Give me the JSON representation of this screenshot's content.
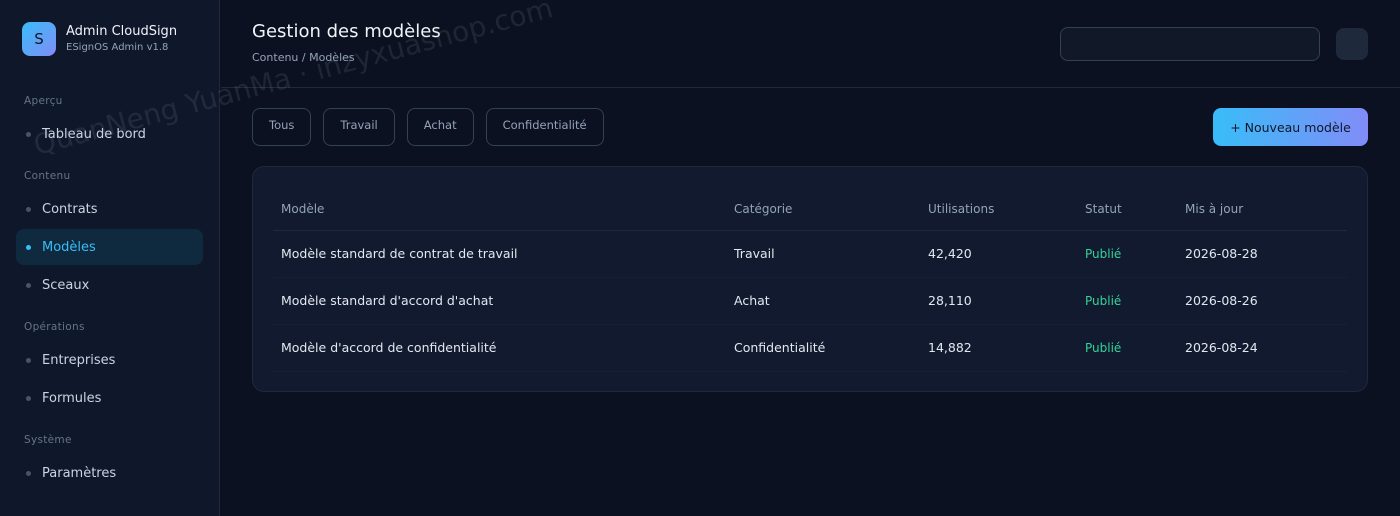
{
  "brand": {
    "logo_letter": "S",
    "title": "Admin CloudSign",
    "subtitle": "ESignOS Admin v1.8"
  },
  "sidebar": {
    "sections": [
      {
        "label": "Aperçu"
      },
      {
        "label": "Contenu"
      },
      {
        "label": "Opérations"
      },
      {
        "label": "Système"
      }
    ],
    "items": [
      {
        "label": "Tableau de bord",
        "active": false
      },
      {
        "label": "Contrats",
        "active": false
      },
      {
        "label": "Modèles",
        "active": true
      },
      {
        "label": "Sceaux",
        "active": false
      },
      {
        "label": "Entreprises",
        "active": false
      },
      {
        "label": "Formules",
        "active": false
      },
      {
        "label": "Paramètres",
        "active": false
      }
    ]
  },
  "header": {
    "title": "Gestion des modèles",
    "breadcrumb": "Contenu / Modèles",
    "search_value": ""
  },
  "filters": [
    "Tous",
    "Travail",
    "Achat",
    "Confidentialité"
  ],
  "actions": {
    "new_label": "+ Nouveau modèle"
  },
  "table": {
    "columns": [
      "Modèle",
      "Catégorie",
      "Utilisations",
      "Statut",
      "Mis à jour"
    ],
    "rows": [
      [
        "Modèle standard de contrat de travail",
        "Travail",
        "42,420",
        "Publié",
        "2026-08-28"
      ],
      [
        "Modèle standard d'accord d'achat",
        "Achat",
        "28,110",
        "Publié",
        "2026-08-26"
      ],
      [
        "Modèle d'accord de confidentialité",
        "Confidentialité",
        "14,882",
        "Publié",
        "2026-08-24"
      ]
    ]
  },
  "watermark": "QuanNeng YuanMa · inzyxuashop.com",
  "colors": {
    "accent": "#38bdf8",
    "accent_end": "#818cf8",
    "status_published": "#34d399",
    "background": "#0b1120"
  }
}
